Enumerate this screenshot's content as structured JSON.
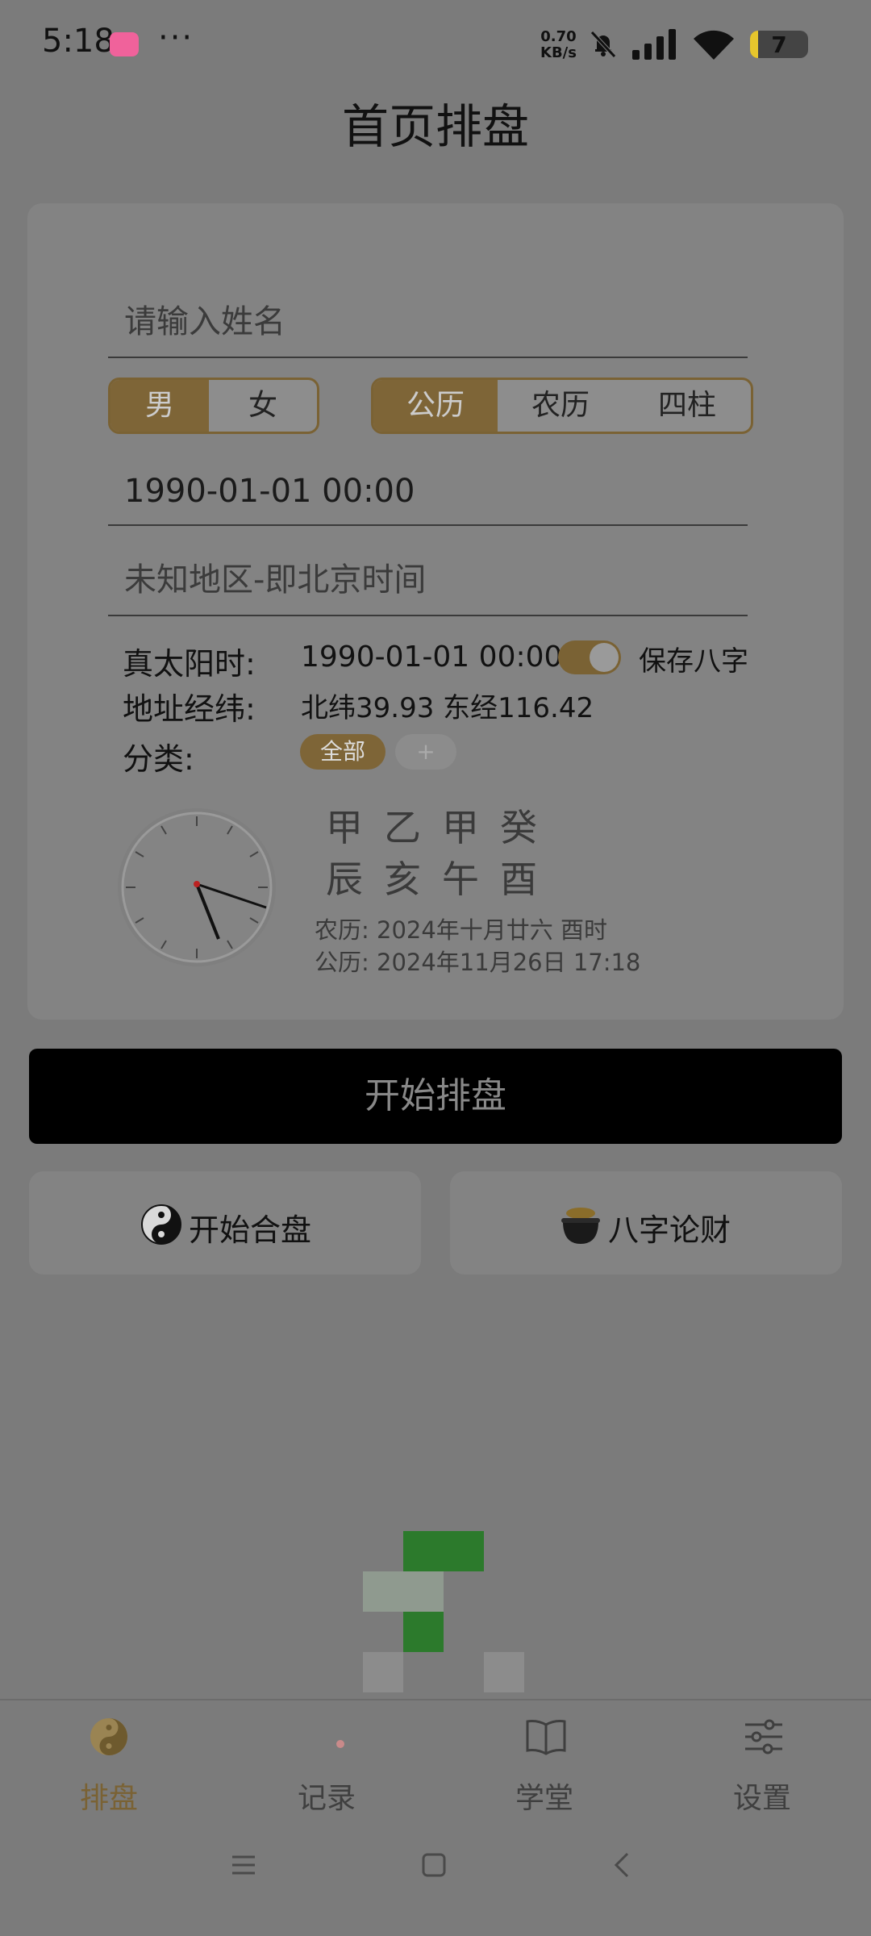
{
  "status_bar": {
    "time": "5:18",
    "more": "···",
    "net_speed_value": "0.70",
    "net_speed_unit": "KB/s",
    "battery_level": "7"
  },
  "header": {
    "title": "首页排盘"
  },
  "form": {
    "name_placeholder": "请输入姓名",
    "gender_options": [
      "男",
      "女"
    ],
    "gender_selected": "男",
    "calendar_options": [
      "公历",
      "农历",
      "四柱"
    ],
    "calendar_selected": "公历",
    "datetime": "1990-01-01 00:00",
    "region": "未知地区-即北京时间",
    "true_solar_label": "真太阳时:",
    "true_solar_value": "1990-01-01 00:00",
    "save_bazi_label": "保存八字",
    "save_bazi_on": true,
    "coords_label": "地址经纬:",
    "coords_value": "北纬39.93 东经116.42",
    "category_label": "分类:",
    "category_chip": "全部",
    "category_add": "+"
  },
  "current": {
    "stems": "甲乙甲癸",
    "branches": "辰亥午酉",
    "lunar_line": "农历: 2024年十月廿六 酉时",
    "solar_line": "公历: 2024年11月26日 17:18"
  },
  "actions": {
    "start_label": "开始排盘",
    "match_label": "开始合盘",
    "wealth_label": "八字论财"
  },
  "tabbar": {
    "items": [
      {
        "label": "排盘",
        "icon": "yin-yang-icon",
        "active": true
      },
      {
        "label": "记录",
        "icon": "record-icon",
        "active": false
      },
      {
        "label": "学堂",
        "icon": "book-icon",
        "active": false
      },
      {
        "label": "设置",
        "icon": "sliders-icon",
        "active": false
      }
    ]
  },
  "colors": {
    "accent": "#7e6537",
    "overlay_bg": "#7b7b7b",
    "card_bg": "#838383",
    "start_button_bg": "#000000",
    "ad_green": "#2c7a2c"
  }
}
